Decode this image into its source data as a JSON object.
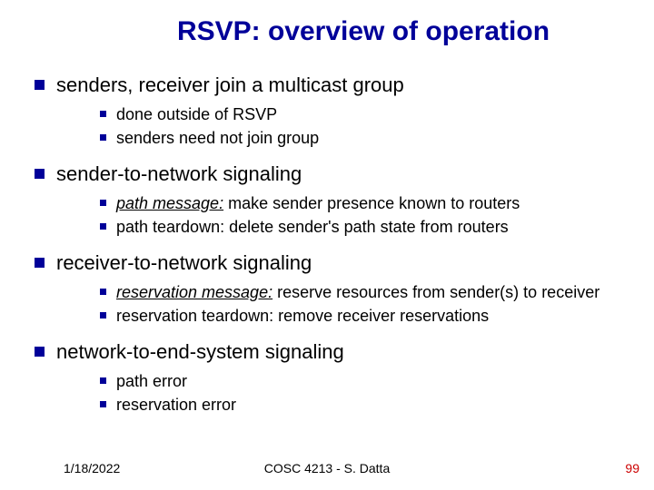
{
  "title": "RSVP: overview of operation",
  "bullets": [
    {
      "text": "senders, receiver join a multicast group",
      "sub": [
        {
          "plain": "done outside of RSVP"
        },
        {
          "plain": "senders need not join group"
        }
      ]
    },
    {
      "text": "sender-to-network signaling",
      "sub": [
        {
          "em": "path message:",
          "rest": " make sender presence known to routers"
        },
        {
          "plain": "path teardown: delete sender's path state from routers"
        }
      ]
    },
    {
      "text": "receiver-to-network signaling",
      "sub": [
        {
          "em": "reservation message:",
          "rest": " reserve resources from sender(s) to receiver"
        },
        {
          "plain": "reservation teardown: remove receiver reservations"
        }
      ]
    },
    {
      "text": "network-to-end-system signaling",
      "sub": [
        {
          "plain": "path error"
        },
        {
          "plain": "reservation error"
        }
      ]
    }
  ],
  "footer": {
    "date": "1/18/2022",
    "center": "COSC 4213 - S. Datta",
    "page": "99"
  }
}
